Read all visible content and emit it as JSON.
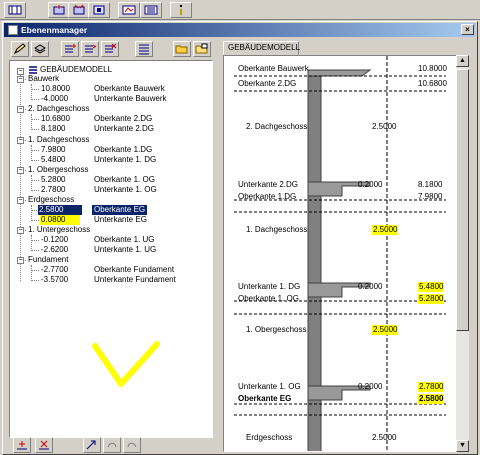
{
  "window": {
    "title": "Ebenenmanager",
    "close_glyph": "×"
  },
  "tab": {
    "label": "GEBÄUDEMODELL"
  },
  "tree": {
    "root": "GEBÄUDEMODELL",
    "groups": [
      {
        "name": "Bauwerk",
        "rows": [
          {
            "value": "10.8000",
            "label": "Oberkante Bauwerk"
          },
          {
            "value": "-4.0000",
            "label": "Unterkante Bauwerk"
          }
        ]
      },
      {
        "name": "2. Dachgeschoss",
        "rows": [
          {
            "value": "10.6800",
            "label": "Oberkante 2.DG"
          },
          {
            "value": "8.1800",
            "label": "Unterkante 2.DG"
          }
        ]
      },
      {
        "name": "1. Dachgeschoss",
        "rows": [
          {
            "value": "7.9800",
            "label": "Oberkante 1.DG"
          },
          {
            "value": "5.4800",
            "label": "Unterkante 1. DG"
          }
        ]
      },
      {
        "name": "1. Obergeschoss",
        "rows": [
          {
            "value": "5.2800",
            "label": "Oberkante 1. OG"
          },
          {
            "value": "2.7800",
            "label": "Unterkante 1. OG"
          }
        ]
      },
      {
        "name": "Erdgeschoss",
        "rows": [
          {
            "value": "2.5800",
            "label": "Oberkante EG"
          },
          {
            "value": "0.0800",
            "label": "Unterkante EG"
          }
        ]
      },
      {
        "name": "1. Untergeschoss",
        "rows": [
          {
            "value": "-0.1200",
            "label": "Oberkante 1. UG"
          },
          {
            "value": "-2.6200",
            "label": "Unterkante 1. UG"
          }
        ]
      },
      {
        "name": "Fundament",
        "rows": [
          {
            "value": "-2.7700",
            "label": "Oberkante Fundament"
          },
          {
            "value": "-3.5700",
            "label": "Unterkante Fundament"
          }
        ]
      }
    ]
  },
  "section": {
    "rows": [
      {
        "left": "Oberkante Bauwerk",
        "mid": "",
        "right": "10.8000"
      },
      {
        "left": "Oberkante 2.DG",
        "mid": "",
        "right": "10.6800"
      },
      {
        "left": "2. Dachgeschoss",
        "mid": "2.5000",
        "right": ""
      },
      {
        "left": "Unterkante 2.DG",
        "mid": "0.2000",
        "right": "8.1800"
      },
      {
        "left": "Oberkante 1.DG",
        "mid": "",
        "right": "7.9800"
      },
      {
        "left": "1. Dachgeschoss",
        "mid": "2.5000",
        "right": ""
      },
      {
        "left": "Unterkante 1. DG",
        "mid": "0.2000",
        "right": "5.4800"
      },
      {
        "left": "Oberkante 1. OG",
        "mid": "",
        "right": "5.2800"
      },
      {
        "left": "1. Obergeschoss",
        "mid": "2.5000",
        "right": ""
      },
      {
        "left": "Unterkante 1. OG",
        "mid": "0.2000",
        "right": "2.7800"
      },
      {
        "left": "Oberkante EG",
        "mid": "",
        "right": "2.5800"
      },
      {
        "left": "Erdgeschoss",
        "mid": "2.5000",
        "right": ""
      }
    ]
  },
  "colors": {
    "highlight": "#ffff00",
    "selection": "#0a246a",
    "titlebar": "#0a246a"
  }
}
